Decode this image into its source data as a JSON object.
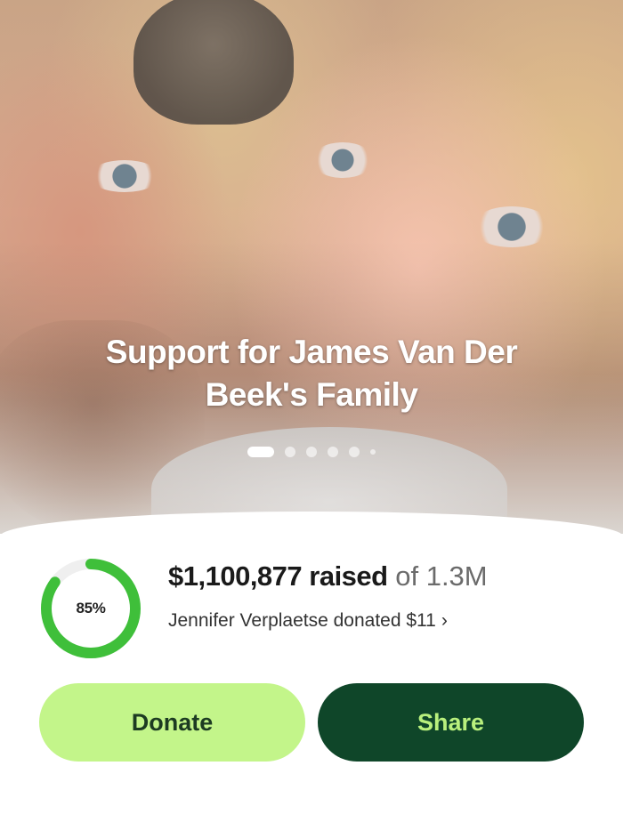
{
  "campaign": {
    "title": "Support for James Van Der Beek's Family",
    "carousel": {
      "total": 6,
      "active_index": 0
    }
  },
  "progress": {
    "percent_label": "85%",
    "percent_value": 85,
    "amount_raised": "$1,100,877 raised",
    "goal_text": "of 1.3M",
    "latest_donation": "Jennifer Verplaetse donated $11",
    "chevron": "›"
  },
  "actions": {
    "donate_label": "Donate",
    "share_label": "Share"
  },
  "colors": {
    "progress_ring": "#3fbf3a",
    "ring_track": "#efefef",
    "donate_bg": "#c3f58a",
    "share_bg": "#0f4629",
    "share_text": "#b9f07d"
  },
  "icons": {
    "carousel_indicator": "dot-icon",
    "donor_chevron": "chevron-right-icon"
  }
}
